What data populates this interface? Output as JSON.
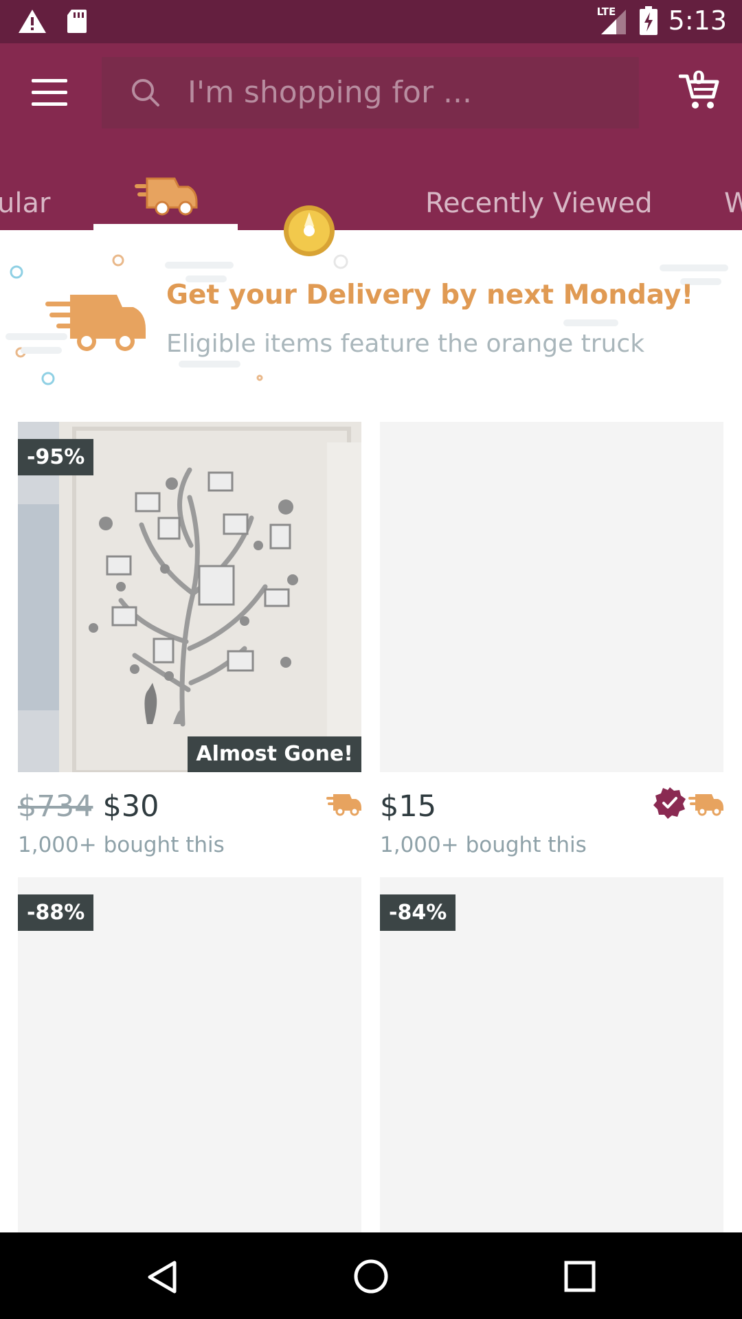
{
  "status_bar": {
    "time": "5:13",
    "network": "LTE",
    "icons": [
      "warning-icon",
      "sd-card-icon",
      "signal-icon",
      "battery-charging-icon"
    ]
  },
  "header": {
    "search_placeholder": "I'm shopping for ...",
    "cart_count": "0",
    "tabs": [
      {
        "label": "ular",
        "type": "text"
      },
      {
        "label": "",
        "icon": "delivery-truck-icon",
        "type": "icon",
        "selected": true
      },
      {
        "label": "",
        "icon": "gold-coin-icon",
        "type": "icon"
      },
      {
        "label": "Recently Viewed",
        "type": "text"
      },
      {
        "label": "W",
        "type": "text"
      }
    ]
  },
  "banner": {
    "title": "Get your Delivery by next Monday!",
    "subtitle": "Eligible items feature the orange truck",
    "icon": "delivery-truck-icon"
  },
  "products": [
    {
      "discount": "-95%",
      "badge": "Almost Gone!",
      "old_price": "$734",
      "price": "$30",
      "sold": "1,000+ bought this",
      "icons": [
        "delivery-truck-icon"
      ]
    },
    {
      "discount": "",
      "badge": "",
      "old_price": "",
      "price": "$15",
      "sold": "1,000+ bought this",
      "icons": [
        "verified-badge-icon",
        "delivery-truck-icon"
      ]
    },
    {
      "discount": "-88%",
      "badge": "",
      "old_price": "",
      "price": "",
      "sold": ""
    },
    {
      "discount": "-84%",
      "badge": "",
      "old_price": "",
      "price": "",
      "sold": ""
    }
  ],
  "colors": {
    "status_bar": "#641f3f",
    "header": "#85294f",
    "accent_orange": "#e09a53",
    "badge_dark": "#3c4546"
  },
  "nav_bar": {
    "icons": [
      "back-icon",
      "home-icon",
      "recents-icon"
    ]
  }
}
